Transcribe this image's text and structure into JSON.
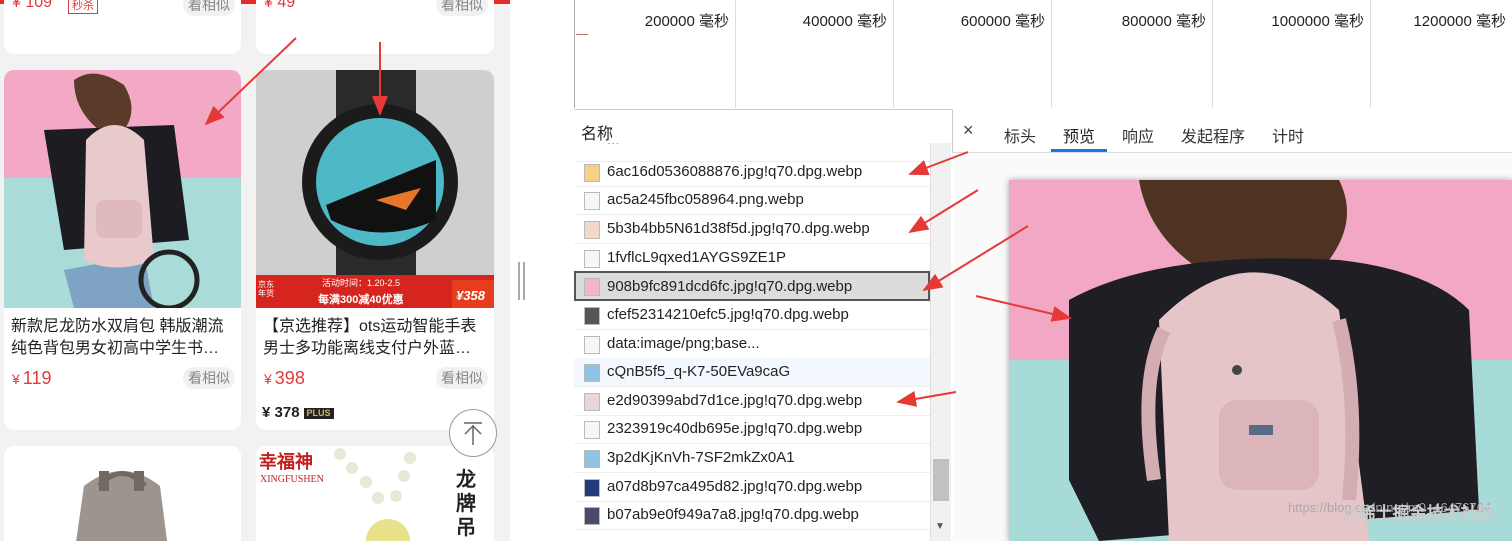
{
  "shop": {
    "top_cards": [
      {
        "price_fragment": "¥ 109",
        "tag": "秒杀",
        "similar": "看相似"
      },
      {
        "price_fragment": "¥ 49",
        "similar": "看相似"
      }
    ],
    "products": [
      {
        "title_line1": "新款尼龙防水双肩包 韩版潮流",
        "title_line2": "纯色背包男女初高中学生书…",
        "currency": "¥",
        "price": "119",
        "similar": "看相似"
      },
      {
        "title_line1": "【京选推荐】ots运动智能手表",
        "title_line2": "男士多功能离线支付户外蓝…",
        "currency": "¥",
        "price": "398",
        "plus_price": "¥ 378",
        "plus_badge": "PLUS",
        "similar": "看相似",
        "image_banner_top": "活动时间：1.20-2.5",
        "image_banner_main": "每满300减40优惠",
        "image_price_tag": "¥358",
        "image_badge": "京东年货"
      }
    ],
    "bottom_cards": [
      {
        "brand_cn": "幸福神",
        "brand_en": "XINGFUSHEN",
        "side_text": "龙牌吊"
      }
    ]
  },
  "timeline": {
    "ticks": [
      "200000 毫秒",
      "400000 毫秒",
      "600000 毫秒",
      "800000 毫秒",
      "1000000 毫秒",
      "1200000 毫秒"
    ]
  },
  "requests": {
    "header": "名称",
    "rows": [
      "6ac16d0536088876.jpg!q70.dpg.webp",
      "ac5a245fbc058964.png.webp",
      "5b3b4bb5N61d38f5d.jpg!q70.dpg.webp",
      "1fvflcL9qxed1AYGS9ZE1P",
      "908b9fc891dcd6fc.jpg!q70.dpg.webp",
      "cfef52314210efc5.jpg!q70.dpg.webp",
      "data:image/png;base...",
      "cQnB5f5_q-K7-50EVa9caG",
      "e2d90399abd7d1ce.jpg!q70.dpg.webp",
      "2323919c40db695e.jpg!q70.dpg.webp",
      "3p2dKjKnVh-7SF2mkZx0A1",
      "a07d8b97ca495d82.jpg!q70.dpg.webp",
      "b07ab9e0f949a7a8.jpg!q70.dpg.webp"
    ]
  },
  "detail": {
    "close": "×",
    "tabs": [
      "标头",
      "预览",
      "响应",
      "发起程序",
      "计时"
    ],
    "active_tab": "预览"
  },
  "watermark": {
    "url": "https://blog.csdn.net/m0_46476764",
    "site": "@稀土掘金技术社区"
  },
  "colors": {
    "accent_red": "#e4393c",
    "annotation_arrow": "#e53935",
    "tab_underline": "#1a73e8"
  }
}
